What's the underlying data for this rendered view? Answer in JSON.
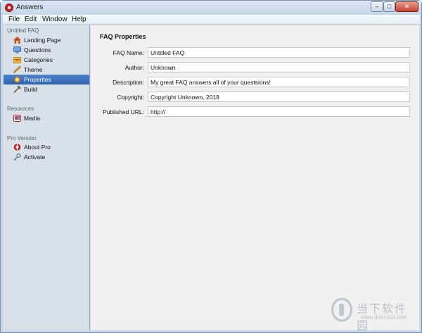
{
  "window": {
    "title": "Answers",
    "minimize_label": "–",
    "maximize_label": "□",
    "close_label": "✕"
  },
  "menu": {
    "items": [
      "File",
      "Edit",
      "Window",
      "Help"
    ]
  },
  "sidebar": {
    "sections": [
      {
        "heading": "Untitled FAQ",
        "items": [
          {
            "label": "Landing Page",
            "icon": "house-icon"
          },
          {
            "label": "Questions",
            "icon": "monitor-icon"
          },
          {
            "label": "Categories",
            "icon": "folder-icon"
          },
          {
            "label": "Theme",
            "icon": "pencil-icon"
          },
          {
            "label": "Properties",
            "icon": "gear-icon",
            "selected": true
          },
          {
            "label": "Build",
            "icon": "hammer-icon"
          }
        ]
      },
      {
        "heading": "Resources",
        "items": [
          {
            "label": "Media",
            "icon": "media-icon"
          }
        ]
      },
      {
        "heading": "Pro Version",
        "items": [
          {
            "label": "About Pro",
            "icon": "lifebuoy-icon"
          },
          {
            "label": "Activate",
            "icon": "key-icon"
          }
        ]
      }
    ]
  },
  "properties": {
    "title": "FAQ Properties",
    "fields": [
      {
        "label": "FAQ Name:",
        "value": "Untitled FAQ"
      },
      {
        "label": "Author:",
        "value": "Unknown"
      },
      {
        "label": "Description:",
        "value": "My great FAQ answers all of your questsions!"
      },
      {
        "label": "Copyright:",
        "value": "Copyright Unknown, 2018"
      },
      {
        "label": "Published URL:",
        "value": "http://"
      }
    ]
  },
  "watermark": {
    "text": "当下软件园",
    "url": "www.downxia.com"
  },
  "colors": {
    "selection": "#3a6fb8",
    "sidebar_bg": "#dae0e8",
    "content_bg": "#f0f0f0"
  }
}
